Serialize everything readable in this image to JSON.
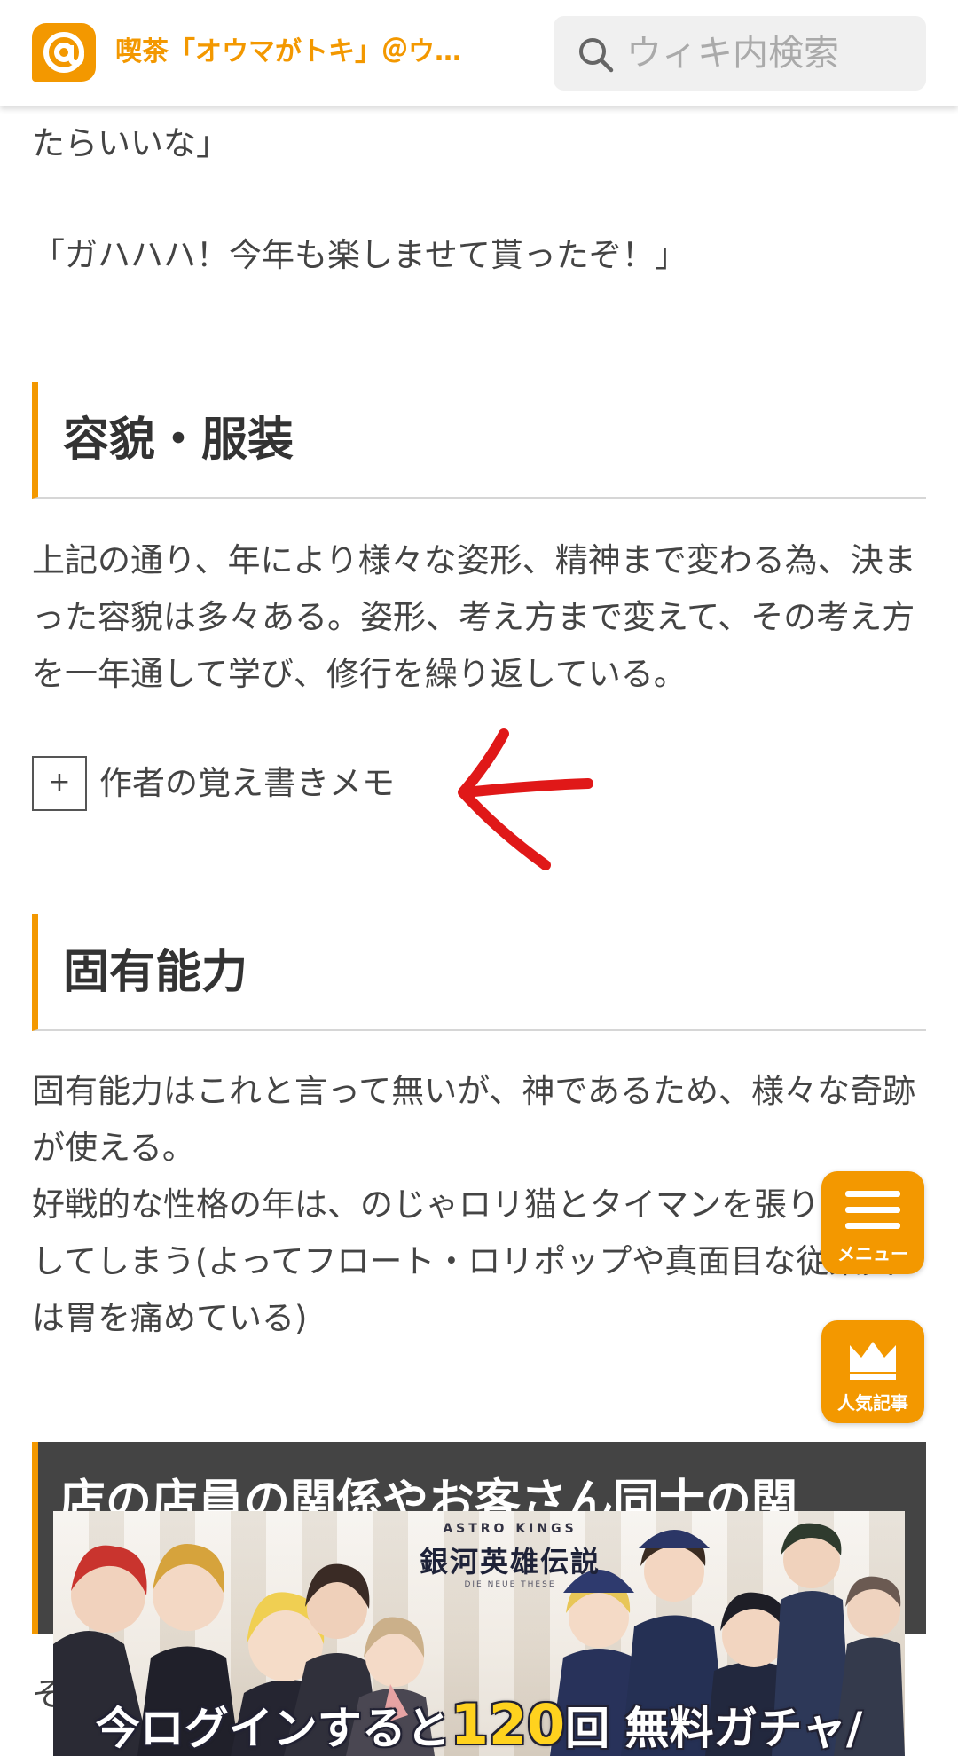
{
  "header": {
    "logo_icon": "at-mark-icon",
    "site_title": "喫茶「オウマがトキ」＠ウ…",
    "search_placeholder": "ウィキ内検索"
  },
  "content": {
    "intro_tail": "たらいいな」",
    "quote": "「ガハハハ！今年も楽しませて貰ったぞ！」",
    "section_appearance": {
      "title": "容貌・服装",
      "body": "上記の通り、年により様々な姿形、精神まで変わる為、決まった容貌は多々ある。姿形、考え方まで変えて、その考え方を一年通して学び、修行を繰り返している。"
    },
    "memo": {
      "toggle": "+",
      "label": "作者の覚え書きメモ"
    },
    "section_ability": {
      "title": "固有能力",
      "body_1": "固有能力はこれと言って無いが、神であるため、様々な奇跡が使える。",
      "body_2": "好戦的な性格の年は、のじゃロリ猫とタイマンを張り店を壊してしまう(よってフロート・ロリポップや真面目な従業員は胃を痛めている)"
    },
    "section_relations": {
      "title": "店の店員の関係やお客さん同士の関"
    },
    "under_ad_text": "そ"
  },
  "floating": {
    "menu_label": "メニュー",
    "menu_icon": "hamburger-menu-icon",
    "popular_label": "人気記事",
    "popular_icon": "crown-icon"
  },
  "ad": {
    "brand": "ASTRO KINGS",
    "title": "銀河英雄伝説",
    "subtitle": "DIE NEUE THESE",
    "cta_prefix": "今ログインすると",
    "cta_number": "120",
    "cta_suffix": "回 無料ガチャ/"
  },
  "colors": {
    "accent": "#f39800",
    "annotation_arrow": "#e01818",
    "dark_heading_bg": "#444444"
  }
}
